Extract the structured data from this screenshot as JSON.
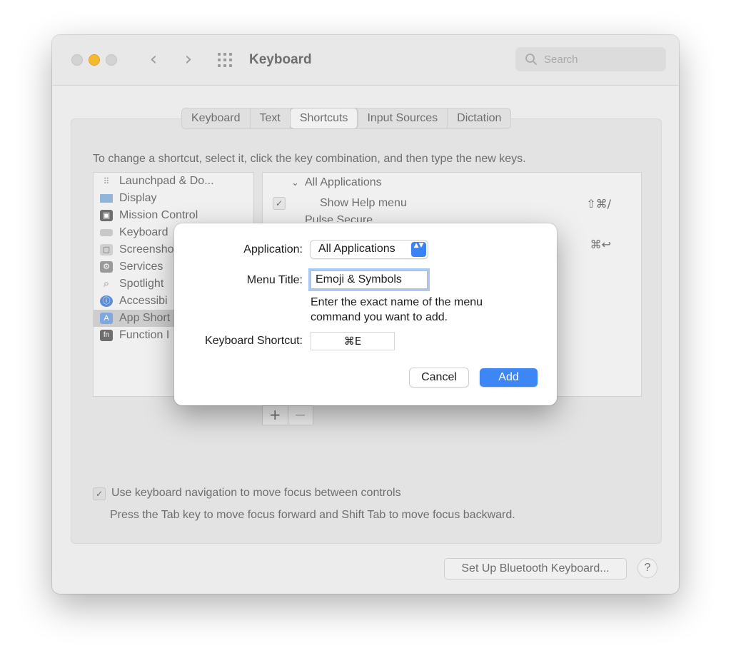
{
  "window": {
    "title": "Keyboard",
    "search_placeholder": "Search"
  },
  "nav": {
    "back": "‹",
    "forward": "›"
  },
  "tabs": [
    {
      "label": "Keyboard"
    },
    {
      "label": "Text"
    },
    {
      "label": "Shortcuts",
      "active": true
    },
    {
      "label": "Input Sources"
    },
    {
      "label": "Dictation"
    }
  ],
  "instructions": "To change a shortcut, select it, click the key combination, and then type the new keys.",
  "categories": [
    {
      "label": "Launchpad & Do...",
      "glyph": "⠿"
    },
    {
      "label": "Display",
      "glyph": ""
    },
    {
      "label": "Mission Control",
      "glyph": "▣"
    },
    {
      "label": "Keyboard",
      "glyph": ""
    },
    {
      "label": "Screensho",
      "glyph": "▢"
    },
    {
      "label": "Services",
      "glyph": "⚙"
    },
    {
      "label": "Spotlight",
      "glyph": "⌕"
    },
    {
      "label": "Accessibi",
      "glyph": "ⓘ"
    },
    {
      "label": "App Short",
      "glyph": "A",
      "selected": true
    },
    {
      "label": "Function I",
      "glyph": "fn"
    }
  ],
  "shortcuts": {
    "group": "All Applications",
    "group_arrow": "⌄",
    "rows": [
      {
        "label": "Show Help menu",
        "key": "⇧⌘/",
        "check": "✓"
      },
      {
        "label": "Pulse Secure",
        "key": ""
      },
      {
        "label": "",
        "key": "⌘↩"
      }
    ]
  },
  "plus_minus": {
    "plus": "+",
    "minus": "−"
  },
  "nav_option": {
    "check": "✓",
    "label": "Use keyboard navigation to move focus between controls",
    "help": "Press the Tab key to move focus forward and Shift Tab to move focus backward."
  },
  "bottom": {
    "bluetooth_button": "Set Up Bluetooth Keyboard...",
    "help_button": "?"
  },
  "dialog": {
    "application_label": "Application:",
    "application_value": "All Applications",
    "select_arrows": "▲▼",
    "menu_title_label": "Menu Title:",
    "menu_title_value": "Emoji & Symbols",
    "hint": "Enter the exact name of the menu command you want to add.",
    "shortcut_label": "Keyboard Shortcut:",
    "shortcut_value": "⌘E",
    "cancel": "Cancel",
    "add": "Add"
  },
  "colors": {
    "accent": "#3d86f6",
    "traffic_yellow": "#f5b82e"
  }
}
